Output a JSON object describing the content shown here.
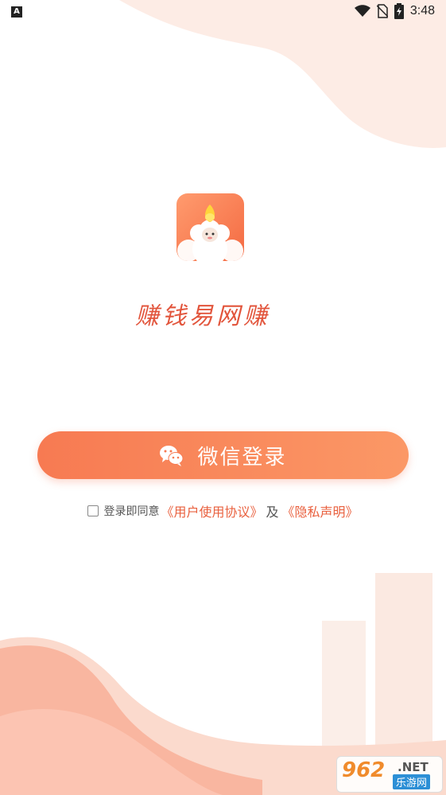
{
  "status_bar": {
    "indicator": "A",
    "time": "3:48",
    "icons": [
      "wifi-icon",
      "no-sim-icon",
      "battery-charging-icon"
    ]
  },
  "app": {
    "icon": "sheep-mascot-icon",
    "name": "赚钱易网赚"
  },
  "login": {
    "button_icon": "wechat-icon",
    "button_label": "微信登录"
  },
  "agreement": {
    "checked": false,
    "prefix": "登录即同意",
    "user_agreement_link": "《用户使用协议》",
    "conjunction": "及",
    "privacy_link": "《隐私声明》"
  },
  "watermark": {
    "number": "962",
    "suffix": ".NET",
    "site_name": "乐游网"
  },
  "colors": {
    "accent": "#f46a42",
    "button_start": "#f77a52",
    "button_end": "#fb9866",
    "link": "#e9603e",
    "bg_shape": "#fbd5c8"
  }
}
